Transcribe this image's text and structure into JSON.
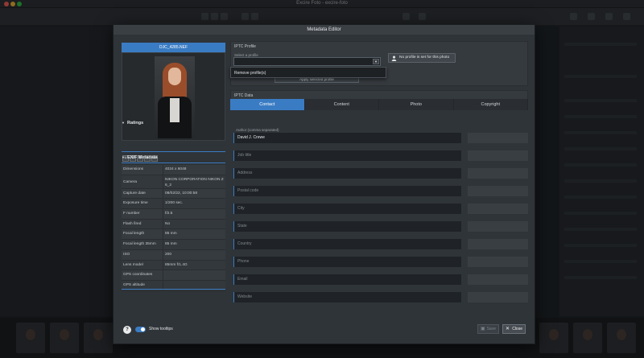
{
  "app": {
    "title": "Excire Foto - excire-foto"
  },
  "modal": {
    "title": "Metadata Editor",
    "filename": "DJC_4285.NEF",
    "ratings_label": "Ratings",
    "exif_label": "EXIF Metadata",
    "color_labels": [
      "#d9412f",
      "#e8a326",
      "#56b84d",
      "#3f7fd3",
      "#8e4ec6"
    ],
    "exif": [
      {
        "key": "Dimensions",
        "value": "4024 x 6048"
      },
      {
        "key": "Camera",
        "value": "NIKON CORPORATION NIKON Z 6_2"
      },
      {
        "key": "Capture date",
        "value": "08/02/22, 10:00:58"
      },
      {
        "key": "Exposure time",
        "value": "1/200 sec."
      },
      {
        "key": "F number",
        "value": "f/2.5"
      },
      {
        "key": "Flash fired",
        "value": "No"
      },
      {
        "key": "Focal length",
        "value": "85 mm"
      },
      {
        "key": "Focal length 35mm",
        "value": "85 mm"
      },
      {
        "key": "ISO",
        "value": "200"
      },
      {
        "key": "Lens model",
        "value": "85mm f/1.4G"
      },
      {
        "key": "GPS coordinates",
        "value": ""
      },
      {
        "key": "GPS altitude",
        "value": ""
      }
    ],
    "iptc_profile": {
      "title": "IPTC Profile",
      "select_label": "Select a profile",
      "select_value": "",
      "no_profile_button": "No profile is set for this photo",
      "apply_button": "Apply selected profile",
      "dropdown_item": "Remove profile(s)"
    },
    "iptc_data": {
      "title": "IPTC Data",
      "tabs": [
        "Contact",
        "Content",
        "Photo",
        "Copyright"
      ],
      "author_label": "Author (comma separated)",
      "author_value": "David J. Crewe",
      "fields": [
        "Job title",
        "Address",
        "Postal code",
        "City",
        "State",
        "Country",
        "Phone",
        "Email",
        "Website"
      ]
    },
    "footer": {
      "help": "?",
      "tooltips_label": "Show tooltips",
      "save_label": "Save",
      "close_label": "Close"
    }
  }
}
